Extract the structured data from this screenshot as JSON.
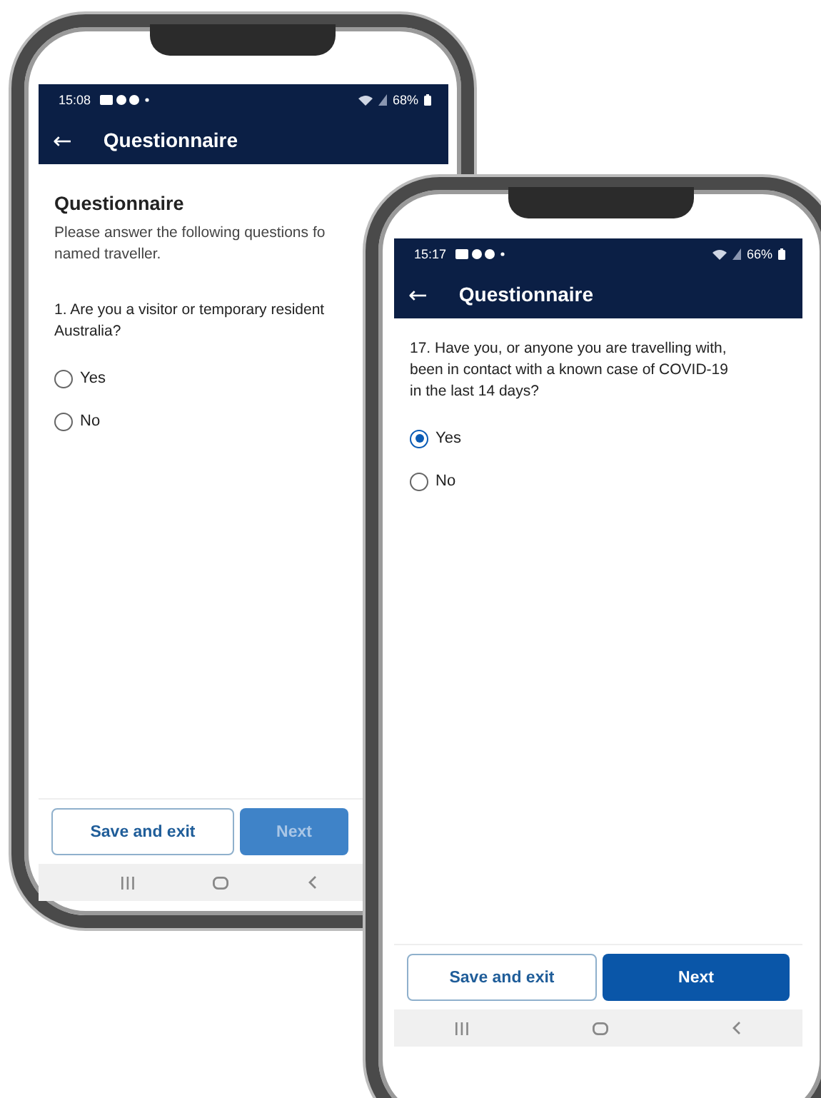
{
  "phones": [
    {
      "status_bar": {
        "time": "15:08",
        "battery": "68%"
      },
      "app_bar": {
        "back": "←",
        "title": "Questionnaire"
      },
      "heading": "Questionnaire",
      "intro_lines": [
        "Please answer the following questions fo",
        "named traveller."
      ],
      "question_lines": [
        "1. Are you a visitor or temporary resident",
        "Australia?"
      ],
      "options": [
        {
          "label": "Yes",
          "selected": false
        },
        {
          "label": "No",
          "selected": false
        }
      ],
      "buttons": [
        {
          "label": "Save and exit",
          "kind": "secondary",
          "disabled": false
        },
        {
          "label": "Next",
          "kind": "primary",
          "disabled": true
        }
      ]
    },
    {
      "status_bar": {
        "time": "15:17",
        "battery": "66%"
      },
      "app_bar": {
        "back": "←",
        "title": "Questionnaire"
      },
      "question_lines": [
        "17. Have you, or anyone you are travelling with,",
        "been in contact with a known case of COVID-19",
        "in the last 14 days?"
      ],
      "options": [
        {
          "label": "Yes",
          "selected": true
        },
        {
          "label": "No",
          "selected": false
        }
      ],
      "buttons": [
        {
          "label": "Save and exit",
          "kind": "secondary",
          "disabled": false
        },
        {
          "label": "Next",
          "kind": "primary",
          "disabled": false
        }
      ]
    }
  ]
}
